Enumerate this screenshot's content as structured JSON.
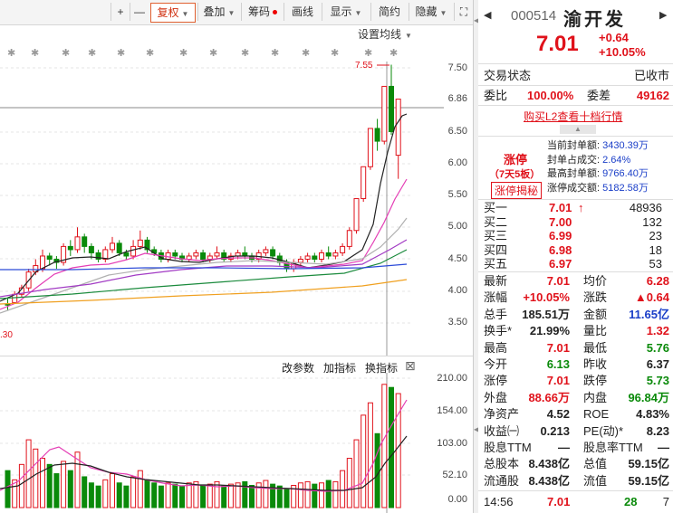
{
  "toolbar": {
    "plus": "+",
    "minus": "—",
    "fuquan": "复权",
    "diejia": "叠加",
    "choума": "筹码",
    "huaxian": "画线",
    "xianshi": "显示",
    "jianyue": "简约",
    "yincang": "隐藏",
    "expand": "⛶"
  },
  "chart": {
    "settings_label": "设置均线",
    "max_marker": "7.55",
    "min_marker": ".30",
    "price_axis": [
      "7.50",
      "6.86",
      "6.50",
      "6.00",
      "5.50",
      "5.00",
      "4.50",
      "4.00",
      "3.50"
    ],
    "vol_axis": [
      "210.00",
      "154.00",
      "103.00",
      "52.10",
      "0.00"
    ],
    "indicator_buttons": [
      "改参数",
      "加指标",
      "换指标"
    ],
    "close_icon": "⊠",
    "colors": {
      "up": "#e0121b",
      "down": "#0a8a0a"
    }
  },
  "stock": {
    "code": "000514",
    "name": "渝开发",
    "price": "7.01",
    "change": "+0.64",
    "change_pct": "+10.05%",
    "status_label": "交易状态",
    "status_value": "已收市",
    "weibi_label": "委比",
    "weibi_value": "100.00%",
    "weicha_label": "委差",
    "weicha_value": "49162",
    "buy_l2": "购买L2查看十档行情",
    "limit_up_label": "涨停",
    "limit_up_streak": "（7天5板）",
    "limit_up_secret": "涨停揭秘",
    "seal_rows": [
      {
        "label": "当前封单额:",
        "value": "3430.39万"
      },
      {
        "label": "封单占成交:",
        "value": "2.64%"
      },
      {
        "label": "最高封单额:",
        "value": "9766.40万"
      },
      {
        "label": "涨停成交额:",
        "value": "5182.58万"
      }
    ],
    "bids": [
      {
        "label": "买一",
        "price": "7.01",
        "vol": "48936"
      },
      {
        "label": "买二",
        "price": "7.00",
        "vol": "132"
      },
      {
        "label": "买三",
        "price": "6.99",
        "vol": "23"
      },
      {
        "label": "买四",
        "price": "6.98",
        "vol": "18"
      },
      {
        "label": "买五",
        "price": "6.97",
        "vol": "53"
      }
    ],
    "stats": [
      {
        "l1": "最新",
        "v1": "7.01",
        "c1": "red",
        "l2": "均价",
        "v2": "6.28",
        "c2": "red"
      },
      {
        "l1": "涨幅",
        "v1": "+10.05%",
        "c1": "red",
        "l2": "涨跌",
        "v2": "▲0.64",
        "c2": "red"
      },
      {
        "l1": "总手",
        "v1": "185.51万",
        "c1": "",
        "l2": "金额",
        "v2": "11.65亿",
        "c2": "blue"
      },
      {
        "l1": "换手*",
        "v1": "21.99%",
        "c1": "",
        "l2": "量比",
        "v2": "1.32",
        "c2": "red"
      },
      {
        "l1": "最高",
        "v1": "7.01",
        "c1": "red",
        "l2": "最低",
        "v2": "5.76",
        "c2": "green"
      },
      {
        "l1": "今开",
        "v1": "6.13",
        "c1": "green",
        "l2": "昨收",
        "v2": "6.37",
        "c2": ""
      },
      {
        "l1": "涨停",
        "v1": "7.01",
        "c1": "red",
        "l2": "跌停",
        "v2": "5.73",
        "c2": "green"
      },
      {
        "l1": "外盘",
        "v1": "88.66万",
        "c1": "red",
        "l2": "内盘",
        "v2": "96.84万",
        "c2": "green"
      },
      {
        "l1": "净资产",
        "v1": "4.52",
        "c1": "",
        "l2": "ROE",
        "v2": "4.83%",
        "c2": ""
      },
      {
        "l1": "收益㈠",
        "v1": "0.213",
        "c1": "",
        "l2": "PE(动)*",
        "v2": "8.23",
        "c2": ""
      },
      {
        "l1": "股息TTM",
        "v1": "—",
        "c1": "",
        "l2": "股息率TTM",
        "v2": "—",
        "c2": ""
      },
      {
        "l1": "总股本",
        "v1": "8.438亿",
        "c1": "",
        "l2": "总值",
        "v2": "59.15亿",
        "c2": ""
      },
      {
        "l1": "流通股",
        "v1": "8.438亿",
        "c1": "",
        "l2": "流值",
        "v2": "59.15亿",
        "c2": ""
      }
    ],
    "tick": {
      "time": "14:56",
      "price": "7.01",
      "vol": "28",
      "count": "7"
    }
  }
}
